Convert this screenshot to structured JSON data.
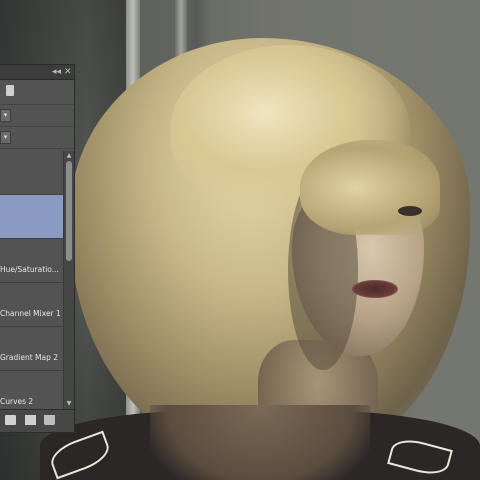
{
  "panel": {
    "controls": {
      "collapse": "◂◂",
      "close": "✕"
    },
    "layers": [
      {
        "label": ""
      },
      {
        "label": ""
      },
      {
        "label": "Hue/Saturatio..."
      },
      {
        "label": "Channel Mixer 1"
      },
      {
        "label": "Gradient Map 2"
      },
      {
        "label": "Curves 2"
      }
    ],
    "icons": {
      "tab": "adjustments-icon",
      "folder": "folder-icon",
      "new": "new-layer-icon",
      "delete": "trash-icon"
    },
    "selected_index": 1,
    "scroll_position": 0.15
  },
  "colors": {
    "panel_bg": "#535353",
    "selected_row": "#8a9ac0"
  }
}
